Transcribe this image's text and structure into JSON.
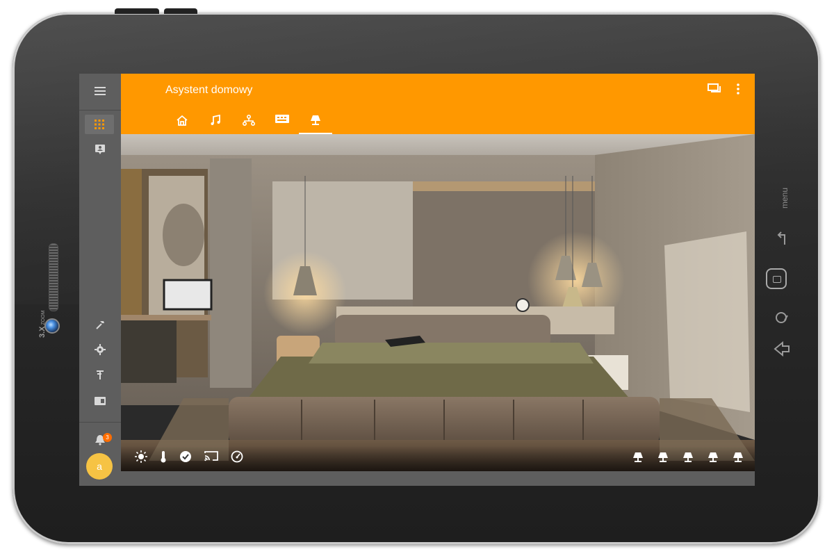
{
  "app": {
    "title": "Asystent domowy",
    "accent_color": "#ff9800"
  },
  "device": {
    "zoom_label": "3.X",
    "zoom_sublabel": "ZOOM",
    "menu_label": "menu"
  },
  "sidebar": {
    "top_items": [
      {
        "icon": "hamburger-menu-icon"
      },
      {
        "icon": "apps-grid-icon",
        "active": true
      },
      {
        "icon": "account-box-icon"
      }
    ],
    "bottom_items": [
      {
        "icon": "hammer-icon"
      },
      {
        "icon": "gear-icon"
      },
      {
        "icon": "antenna-icon"
      },
      {
        "icon": "card-icon"
      }
    ],
    "notification_count": "3",
    "avatar_letter": "a"
  },
  "appbar": {
    "actions": [
      {
        "icon": "chat-icon"
      },
      {
        "icon": "more-vert-icon"
      }
    ]
  },
  "tabs": [
    {
      "icon": "home-icon"
    },
    {
      "icon": "music-note-icon"
    },
    {
      "icon": "network-icon"
    },
    {
      "icon": "remote-control-icon"
    },
    {
      "icon": "lamp-icon",
      "active": true
    }
  ],
  "toolbar": {
    "left": [
      {
        "icon": "brightness-icon"
      },
      {
        "icon": "thermometer-icon"
      },
      {
        "icon": "check-circle-icon"
      },
      {
        "icon": "cast-icon"
      },
      {
        "icon": "speedometer-icon"
      }
    ],
    "right": [
      {
        "icon": "lamp-icon"
      },
      {
        "icon": "lamp-icon"
      },
      {
        "icon": "lamp-icon"
      },
      {
        "icon": "lamp-icon"
      },
      {
        "icon": "lamp-icon"
      }
    ]
  }
}
